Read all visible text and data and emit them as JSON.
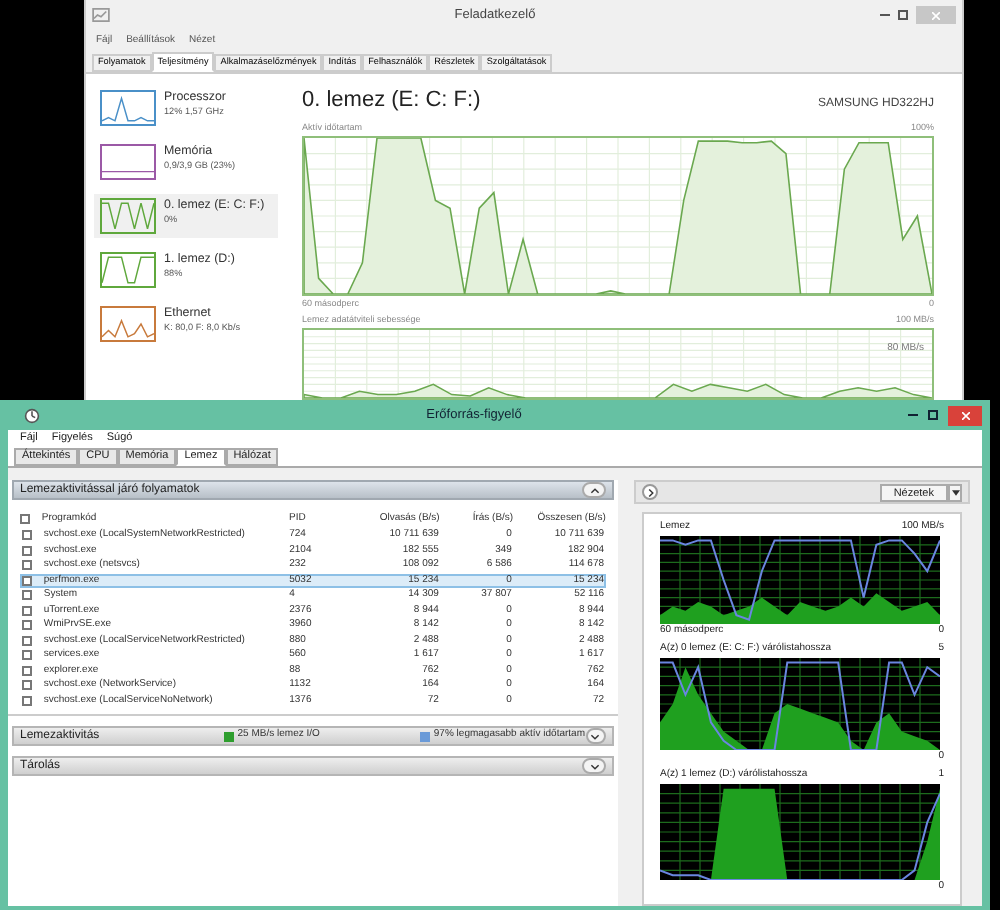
{
  "task_manager": {
    "title": "Feladatkezelő",
    "menu": [
      "Fájl",
      "Beállítások",
      "Nézet"
    ],
    "tabs": [
      {
        "label": "Folyamatok",
        "selected": false
      },
      {
        "label": "Teljesítmény",
        "selected": true
      },
      {
        "label": "Alkalmazáselőzmények",
        "selected": false
      },
      {
        "label": "Indítás",
        "selected": false
      },
      {
        "label": "Felhasználók",
        "selected": false
      },
      {
        "label": "Részletek",
        "selected": false
      },
      {
        "label": "Szolgáltatások",
        "selected": false
      }
    ],
    "sidebar": [
      {
        "name": "Processzor",
        "detail": "12% 1,57 GHz",
        "color": "#4a90c8",
        "selected": false
      },
      {
        "name": "Memória",
        "detail": "0,9/3,9 GB (23%)",
        "color": "#9b59a6",
        "selected": false
      },
      {
        "name": "0. lemez (E: C: F:)",
        "detail": "0%",
        "color": "#5fa83c",
        "selected": true
      },
      {
        "name": "1. lemez (D:)",
        "detail": "88%",
        "color": "#5fa83c",
        "selected": false
      },
      {
        "name": "Ethernet",
        "detail": "K: 80,0 F: 8,0 Kb/s",
        "color": "#c87a3c",
        "selected": false
      }
    ],
    "detail": {
      "title": "0. lemez (E: C: F:)",
      "model": "SAMSUNG HD322HJ",
      "active_label": "Aktív időtartam",
      "active_max": "100%",
      "time_label": "60 másodperc",
      "active_min": "0",
      "rate_label": "Lemez adatátviteli sebessége",
      "rate_max": "100 MB/s",
      "rate_line": "80 MB/s"
    }
  },
  "resource_monitor": {
    "title": "Erőforrás-figyelő",
    "menu": [
      "Fájl",
      "Figyelés",
      "Súgó"
    ],
    "tabs": [
      {
        "label": "Áttekintés",
        "selected": false
      },
      {
        "label": "CPU",
        "selected": false
      },
      {
        "label": "Memória",
        "selected": false
      },
      {
        "label": "Lemez",
        "selected": true
      },
      {
        "label": "Hálózat",
        "selected": false
      }
    ],
    "process_section": {
      "title": "Lemezaktivitással járó folyamatok",
      "expanded": true,
      "all_checked": false,
      "columns": [
        "Programkód",
        "PID",
        "Olvasás (B/s)",
        "Írás (B/s)",
        "Összesen (B/s)"
      ],
      "rows": [
        {
          "cells": [
            "svchost.exe (LocalSystemNetworkRestricted)",
            "724",
            "10 711 639",
            "0",
            "10 711 639"
          ],
          "checked": false,
          "selected": false
        },
        {
          "cells": [
            "svchost.exe",
            "2104",
            "182 555",
            "349",
            "182 904"
          ],
          "checked": false,
          "selected": false
        },
        {
          "cells": [
            "svchost.exe (netsvcs)",
            "232",
            "108 092",
            "6 586",
            "114 678"
          ],
          "checked": false,
          "selected": false
        },
        {
          "cells": [
            "perfmon.exe",
            "5032",
            "15 234",
            "0",
            "15 234"
          ],
          "checked": false,
          "selected": true
        },
        {
          "cells": [
            "System",
            "4",
            "14 309",
            "37 807",
            "52 116"
          ],
          "checked": false,
          "selected": false
        },
        {
          "cells": [
            "uTorrent.exe",
            "2376",
            "8 944",
            "0",
            "8 944"
          ],
          "checked": false,
          "selected": false
        },
        {
          "cells": [
            "WmiPrvSE.exe",
            "3960",
            "8 142",
            "0",
            "8 142"
          ],
          "checked": false,
          "selected": false
        },
        {
          "cells": [
            "svchost.exe (LocalServiceNetworkRestricted)",
            "880",
            "2 488",
            "0",
            "2 488"
          ],
          "checked": false,
          "selected": false
        },
        {
          "cells": [
            "services.exe",
            "560",
            "1 617",
            "0",
            "1 617"
          ],
          "checked": false,
          "selected": false
        },
        {
          "cells": [
            "explorer.exe",
            "88",
            "762",
            "0",
            "762"
          ],
          "checked": false,
          "selected": false
        },
        {
          "cells": [
            "svchost.exe (NetworkService)",
            "1132",
            "164",
            "0",
            "164"
          ],
          "checked": false,
          "selected": false
        },
        {
          "cells": [
            "svchost.exe (LocalServiceNoNetwork)",
            "1376",
            "72",
            "0",
            "72"
          ],
          "checked": false,
          "selected": false
        }
      ]
    },
    "activity_section": {
      "title": "Lemezaktivitás",
      "expanded": false,
      "legend": [
        {
          "text": "25 MB/s lemez I/O",
          "color": "#2e9e2e"
        },
        {
          "text": "97% legmagasabb aktív időtartam",
          "color": "#6a9ad8"
        }
      ]
    },
    "storage_section": {
      "title": "Tárolás",
      "expanded": false
    },
    "views_button": "Nézetek",
    "graphs": [
      {
        "title": "Lemez",
        "max": "100 MB/s",
        "time": "60 másodperc",
        "min": "0"
      },
      {
        "title": "A(z) 0 lemez (E: C: F:) várólistahossza",
        "max": "5",
        "min": "0"
      },
      {
        "title": "A(z) 1 lemez (D:) várólistahossza",
        "max": "1",
        "min": "0"
      }
    ]
  }
}
